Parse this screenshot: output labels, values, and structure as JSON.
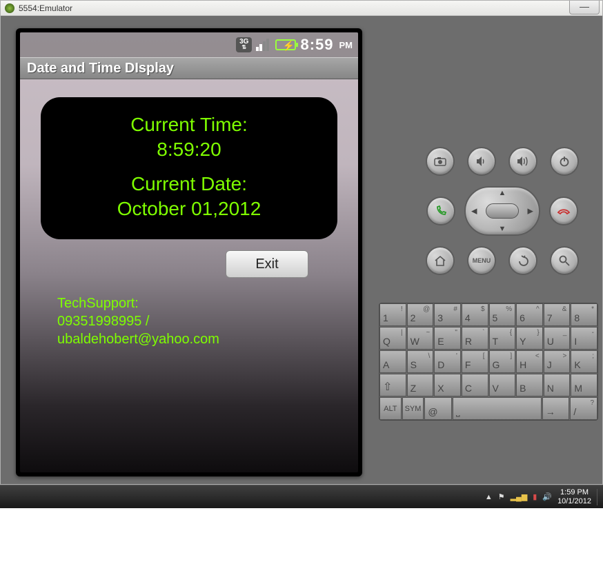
{
  "window": {
    "title": "5554:Emulator"
  },
  "statusbar": {
    "time": "8:59",
    "ampm": "PM",
    "net": "3G"
  },
  "app": {
    "title": "Date and Time DIsplay",
    "time_label": "Current Time:",
    "time_value": "8:59:20",
    "date_label": "Current Date:",
    "date_value": "October 01,2012",
    "exit": "Exit",
    "support_label": "TechSupport:",
    "support_phone": "09351998995 /",
    "support_email": "ubaldehobert@yahoo.com"
  },
  "hw": {
    "menu": "MENU"
  },
  "kbd": {
    "row1": [
      {
        "m": "1",
        "s": "!"
      },
      {
        "m": "2",
        "s": "@"
      },
      {
        "m": "3",
        "s": "#"
      },
      {
        "m": "4",
        "s": "$"
      },
      {
        "m": "5",
        "s": "%"
      },
      {
        "m": "6",
        "s": "^"
      },
      {
        "m": "7",
        "s": "&"
      },
      {
        "m": "8",
        "s": "*"
      }
    ],
    "row2": [
      {
        "m": "Q",
        "s": "|"
      },
      {
        "m": "W",
        "s": "~"
      },
      {
        "m": "E",
        "s": "\""
      },
      {
        "m": "R",
        "s": "`"
      },
      {
        "m": "T",
        "s": "{"
      },
      {
        "m": "Y",
        "s": "}"
      },
      {
        "m": "U",
        "s": "_"
      },
      {
        "m": "I",
        "s": "-"
      }
    ],
    "row3": [
      {
        "m": "A",
        "s": ""
      },
      {
        "m": "S",
        "s": "\\"
      },
      {
        "m": "D",
        "s": "'"
      },
      {
        "m": "F",
        "s": "["
      },
      {
        "m": "G",
        "s": "]"
      },
      {
        "m": "H",
        "s": "<"
      },
      {
        "m": "J",
        "s": ">"
      },
      {
        "m": "K",
        "s": ";"
      }
    ],
    "row4": [
      {
        "m": "⇧",
        "s": ""
      },
      {
        "m": "Z",
        "s": ""
      },
      {
        "m": "X",
        "s": ""
      },
      {
        "m": "C",
        "s": ""
      },
      {
        "m": "V",
        "s": ""
      },
      {
        "m": "B",
        "s": ""
      },
      {
        "m": "N",
        "s": ""
      },
      {
        "m": "M",
        "s": ""
      }
    ],
    "row5": {
      "alt": "ALT",
      "sym": "SYM",
      "at": "@",
      "space": "⎵",
      "arrow": "→",
      "slash": "/",
      "q": "?"
    }
  },
  "taskbar": {
    "arrow": "▲",
    "time": "1:59 PM",
    "date": "10/1/2012"
  }
}
